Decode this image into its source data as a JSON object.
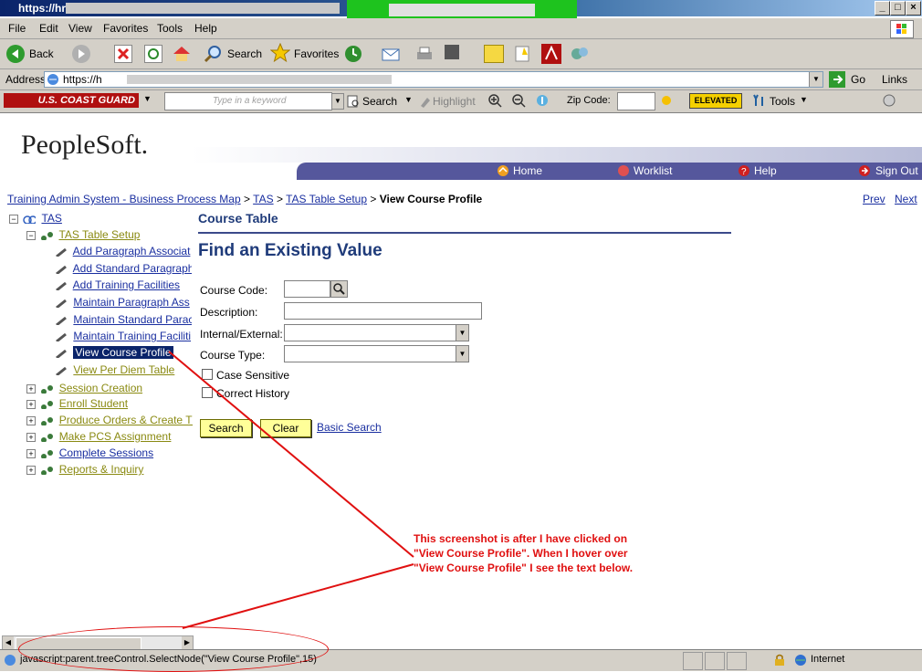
{
  "window": {
    "title": "https://hr",
    "buttons": [
      "_",
      "□",
      "×"
    ]
  },
  "menu": [
    "File",
    "Edit",
    "View",
    "Favorites",
    "Tools",
    "Help"
  ],
  "toolbar": {
    "back": "Back",
    "search": "Search",
    "favorites": "Favorites"
  },
  "addressbar": {
    "label": "Address",
    "url": "https://h",
    "go": "Go",
    "links": "Links"
  },
  "cgbar": {
    "brand": "U.S. COAST GUARD",
    "keyword_placeholder": "Type in a keyword",
    "search": "Search",
    "highlight": "Highlight",
    "zip_label": "Zip Code:",
    "elevated": "ELEVATED",
    "tools": "Tools"
  },
  "peoplesoft": {
    "logo": "PeopleSoft.",
    "nav": [
      "Home",
      "Worklist",
      "Help",
      "Sign Out"
    ]
  },
  "breadcrumb": {
    "items": [
      "Training Admin System - Business Process Map",
      "TAS",
      "TAS Table Setup"
    ],
    "current": "View Course Profile",
    "sep": ">",
    "prev": "Prev",
    "next": "Next"
  },
  "tree": {
    "root": "TAS",
    "group": "TAS Table Setup",
    "children": [
      "Add Paragraph Associat",
      "Add Standard Paragraph",
      "Add Training Facilities",
      "Maintain Paragraph Ass",
      "Maintain Standard Parac",
      "Maintain Training Faciliti",
      "View Course Profile",
      "View Per Diem Table"
    ],
    "other_groups": [
      "Session Creation",
      "Enroll Student",
      "Produce Orders & Create TC",
      "Make PCS Assignment",
      "Complete Sessions",
      "Reports & Inquiry"
    ]
  },
  "form": {
    "section_title": "Course Table",
    "heading": "Find an Existing Value",
    "course_code_label": "Course Code:",
    "description_label": "Description:",
    "internal_external_label": "Internal/External:",
    "course_type_label": "Course Type:",
    "case_sensitive_label": "Case Sensitive",
    "correct_history_label": "Correct History",
    "search_button": "Search",
    "clear_button": "Clear",
    "basic_search_link": "Basic Search"
  },
  "annotation": {
    "line1": "This screenshot is after I have clicked on",
    "line2": "\"View Course Profile\". When I hover over",
    "line3": "\"View Course Profile\" I see the text below."
  },
  "statusbar": {
    "text": "javascript:parent.treeControl.SelectNode(\"View Course Profile\",15)",
    "zone": "Internet"
  },
  "colors": {
    "nav_band": "#55579c",
    "link": "#1a2fa0",
    "annotation": "#e01010",
    "button_yellow": "#ffff99"
  }
}
